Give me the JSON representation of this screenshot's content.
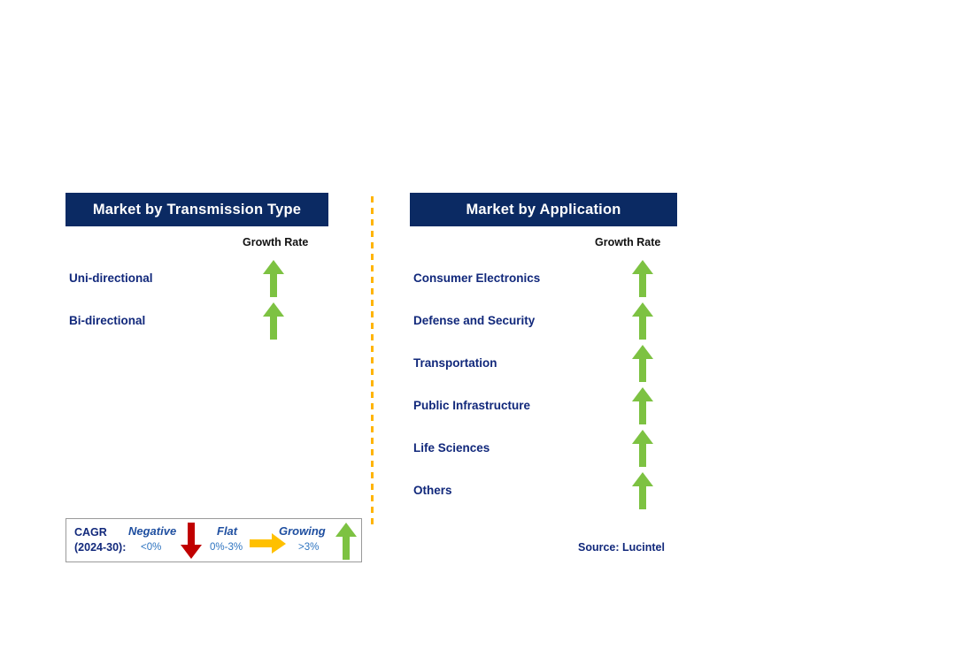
{
  "legend_colors": {
    "header_navy": "#0B2A63",
    "label_navy": "#11287B",
    "growing_green": "#7DC242",
    "negative_red": "#C00000",
    "flat_amber": "#FFC000",
    "divider_amber": "#FFB400",
    "legend_border": "#9A9A9A"
  },
  "panels": [
    {
      "id": "transmission",
      "title": "Market by Transmission Type",
      "column_header": "Growth Rate",
      "rows": [
        {
          "label": "Uni-directional",
          "growth": "Growing",
          "icon": "arrow-up-green"
        },
        {
          "label": "Bi-directional",
          "growth": "Growing",
          "icon": "arrow-up-green"
        }
      ]
    },
    {
      "id": "application",
      "title": "Market by Application",
      "column_header": "Growth Rate",
      "rows": [
        {
          "label": "Consumer Electronics",
          "growth": "Growing",
          "icon": "arrow-up-green"
        },
        {
          "label": "Defense and Security",
          "growth": "Growing",
          "icon": "arrow-up-green"
        },
        {
          "label": "Transportation",
          "growth": "Growing",
          "icon": "arrow-up-green"
        },
        {
          "label": "Public Infrastructure",
          "growth": "Growing",
          "icon": "arrow-up-green"
        },
        {
          "label": "Life Sciences",
          "growth": "Growing",
          "icon": "arrow-up-green"
        },
        {
          "label": "Others",
          "growth": "Growing",
          "icon": "arrow-up-green"
        }
      ]
    }
  ],
  "legend": {
    "cagr_line1": "CAGR",
    "cagr_line2": "(2024-30):",
    "items": [
      {
        "title": "Negative",
        "range": "<0%",
        "icon": "arrow-down-red"
      },
      {
        "title": "Flat",
        "range": "0%-3%",
        "icon": "arrow-right-amber"
      },
      {
        "title": "Growing",
        "range": ">3%",
        "icon": "arrow-up-green"
      }
    ]
  },
  "source": "Source: Lucintel",
  "chart_data": {
    "type": "table",
    "title": "Market Growth Rate by Segment",
    "legend_note": "CAGR (2024-30): Negative <0%, Flat 0%-3%, Growing >3%",
    "legend_position": "bottom-left",
    "source": "Source: Lucintel",
    "series": [
      {
        "name": "Market by Transmission Type",
        "categories": [
          "Uni-directional",
          "Bi-directional"
        ],
        "values": [
          "Growing",
          "Growing"
        ]
      },
      {
        "name": "Market by Application",
        "categories": [
          "Consumer Electronics",
          "Defense and Security",
          "Transportation",
          "Public Infrastructure",
          "Life Sciences",
          "Others"
        ],
        "values": [
          "Growing",
          "Growing",
          "Growing",
          "Growing",
          "Growing",
          "Growing"
        ]
      }
    ]
  }
}
